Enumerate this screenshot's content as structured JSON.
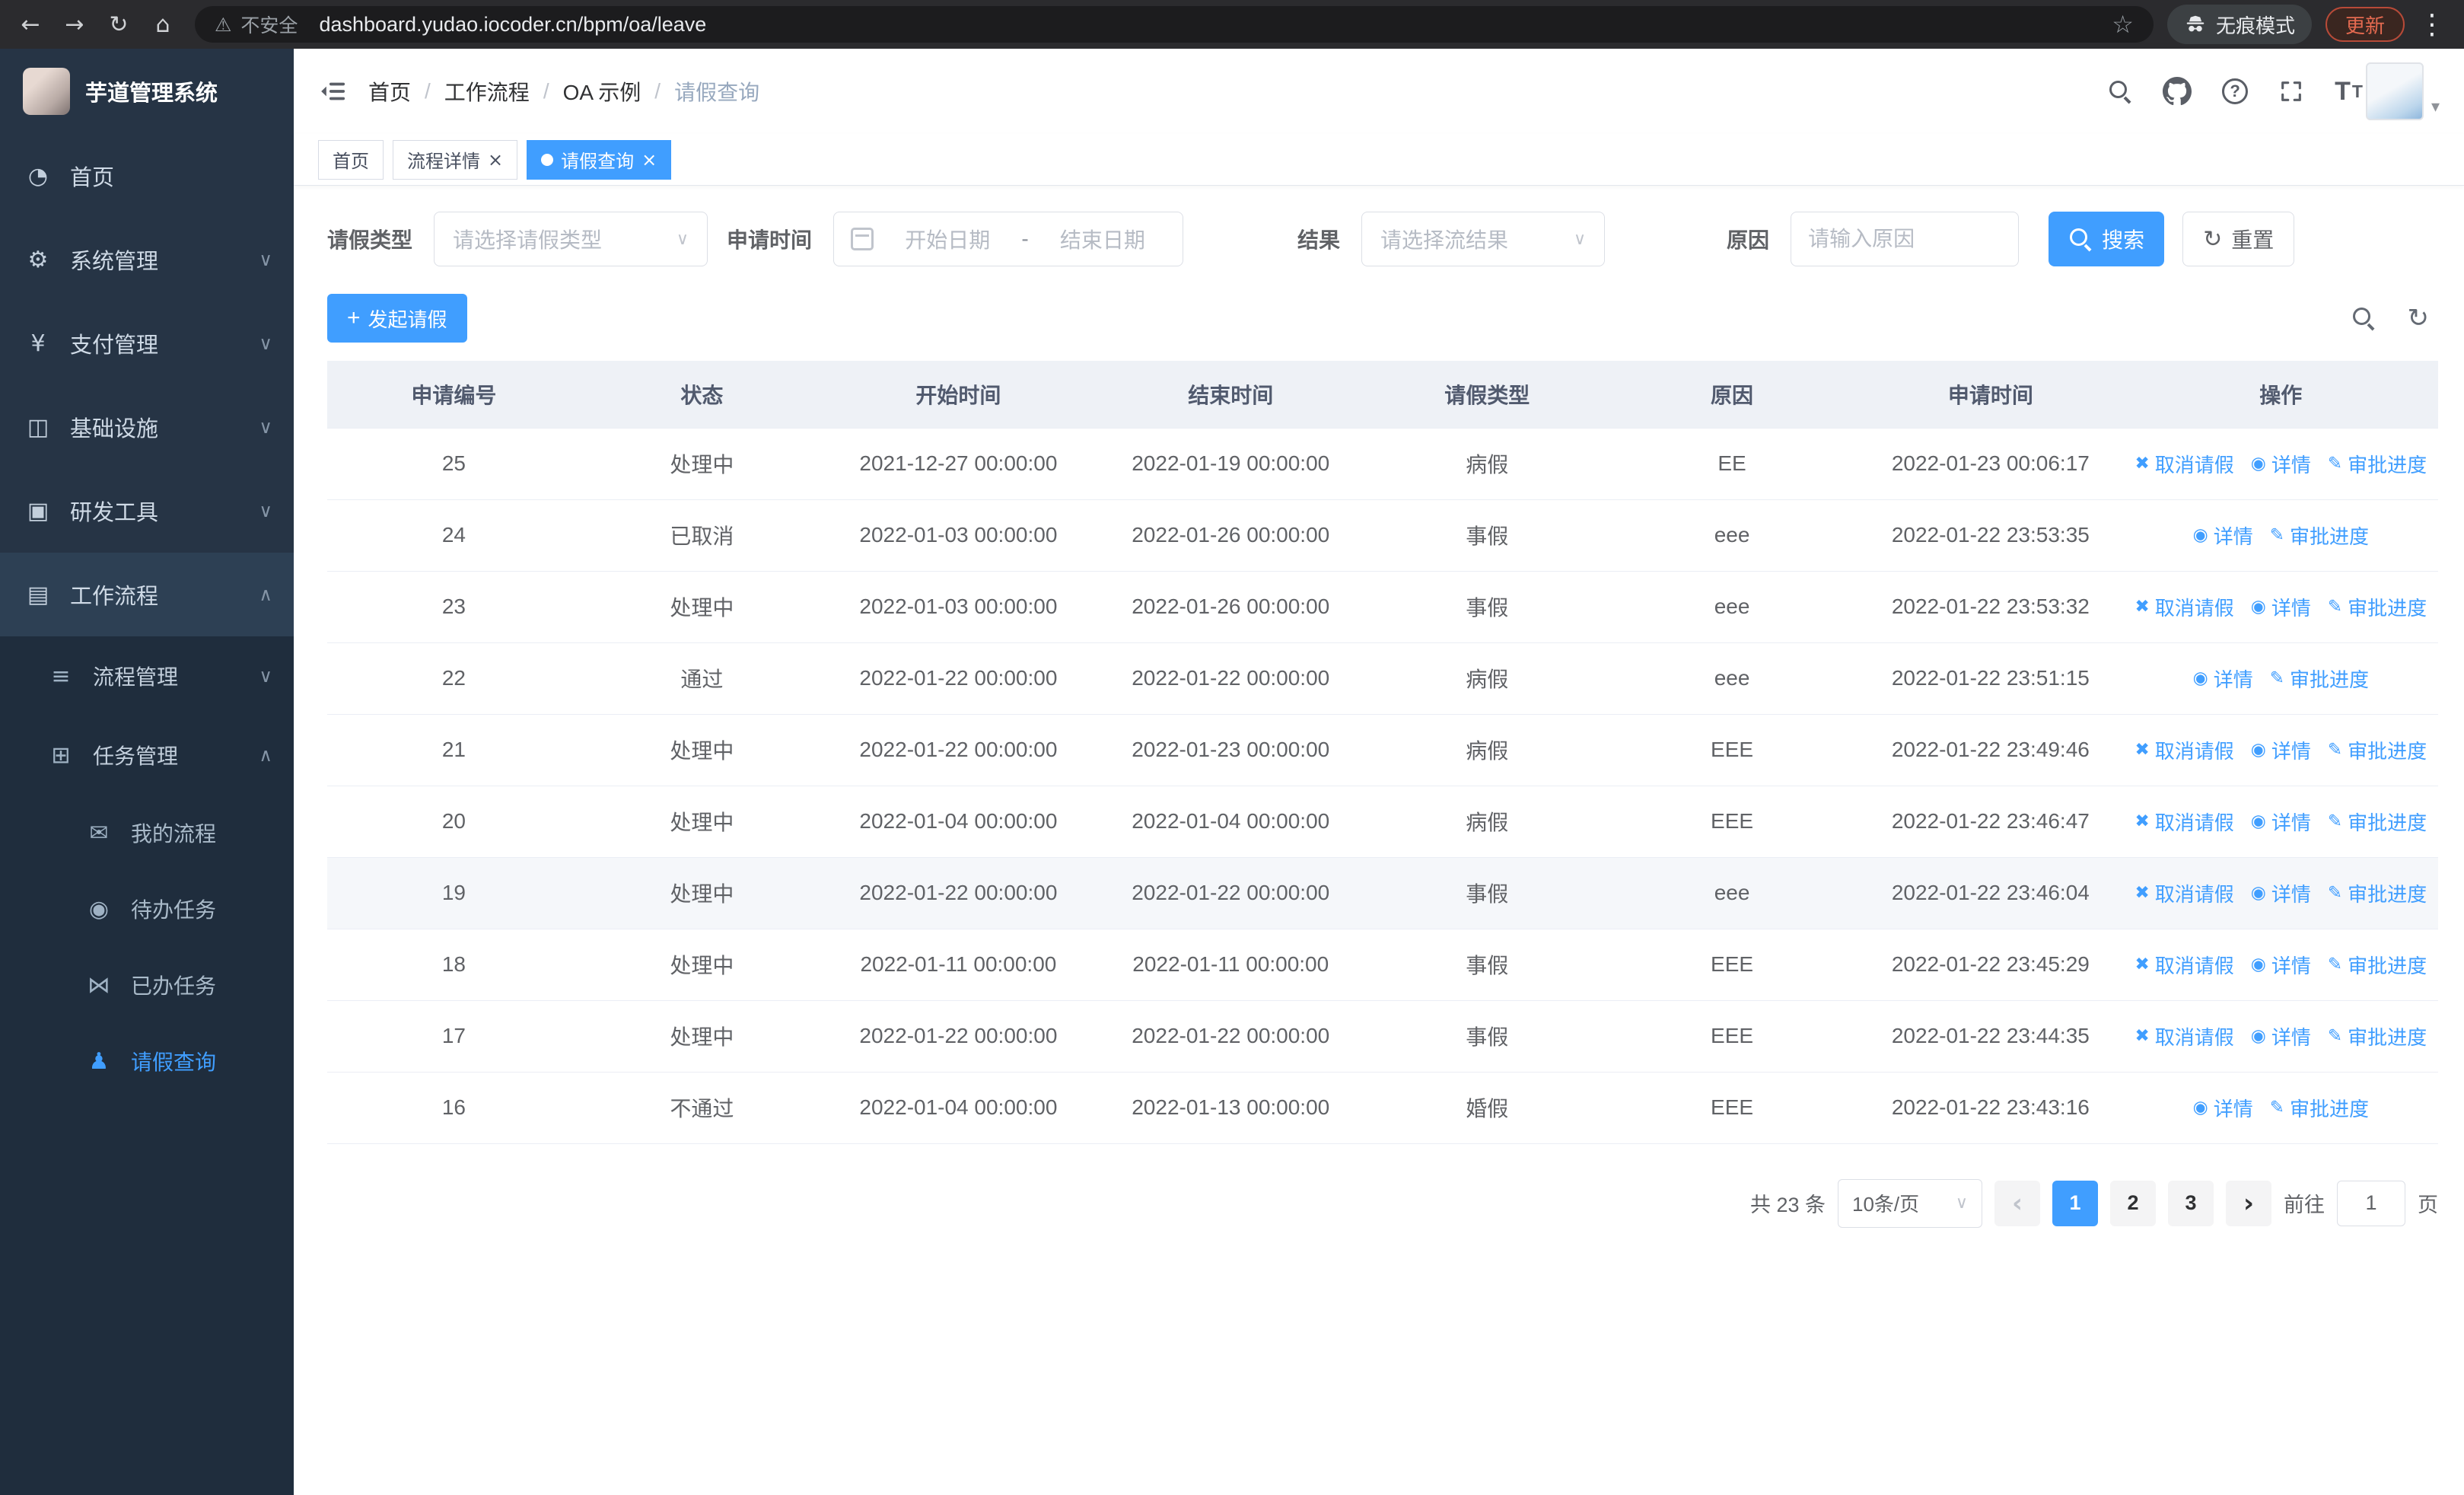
{
  "colors": {
    "accent": "#409eff",
    "sidebar_bg": "#1f2d3d",
    "sidebar_item_bg": "#263445",
    "table_header_bg": "#eef1f6"
  },
  "browser": {
    "nav": [
      "back",
      "forward",
      "reload",
      "home"
    ],
    "security_label": "不安全",
    "url": "dashboard.yudao.iocoder.cn/bpm/oa/leave",
    "incognito_label": "无痕模式",
    "update_label": "更新"
  },
  "sidebar": {
    "app_title": "芋道管理系统",
    "items": [
      {
        "key": "home",
        "label": "首页",
        "icon": "dashboard",
        "level": 1
      },
      {
        "key": "system",
        "label": "系统管理",
        "icon": "gear",
        "level": 1,
        "chevron": "down"
      },
      {
        "key": "payment",
        "label": "支付管理",
        "icon": "yen",
        "level": 1,
        "chevron": "down"
      },
      {
        "key": "infra",
        "label": "基础设施",
        "icon": "monitor",
        "level": 1,
        "chevron": "down"
      },
      {
        "key": "devtools",
        "label": "研发工具",
        "icon": "tools",
        "level": 1,
        "chevron": "down"
      },
      {
        "key": "workflow",
        "label": "工作流程",
        "icon": "briefcase",
        "level": 1,
        "chevron": "up",
        "open": true
      },
      {
        "key": "process-mgmt",
        "label": "流程管理",
        "icon": "list",
        "level": 2,
        "chevron": "down"
      },
      {
        "key": "task-mgmt",
        "label": "任务管理",
        "icon": "tasks",
        "level": 2,
        "chevron": "up",
        "open": true
      },
      {
        "key": "my-process",
        "label": "我的流程",
        "icon": "chat",
        "level": 3
      },
      {
        "key": "todo-tasks",
        "label": "待办任务",
        "icon": "eye",
        "level": 3
      },
      {
        "key": "done-tasks",
        "label": "已办任务",
        "icon": "link",
        "level": 3
      },
      {
        "key": "leave-query",
        "label": "请假查询",
        "icon": "user",
        "level": 3,
        "active": true
      }
    ]
  },
  "header": {
    "breadcrumb": [
      "首页",
      "工作流程",
      "OA 示例",
      "请假查询"
    ],
    "icons": [
      "search",
      "github",
      "help",
      "fullscreen",
      "font-size"
    ]
  },
  "tags": [
    {
      "key": "home",
      "label": "首页",
      "closable": false,
      "active": false
    },
    {
      "key": "process-detail",
      "label": "流程详情",
      "closable": true,
      "active": false
    },
    {
      "key": "leave-query",
      "label": "请假查询",
      "closable": true,
      "active": true
    }
  ],
  "filters": {
    "leave_type_label": "请假类型",
    "leave_type_placeholder": "请选择请假类型",
    "apply_time_label": "申请时间",
    "start_placeholder": "开始日期",
    "range_separator": "-",
    "end_placeholder": "结束日期",
    "result_label": "结果",
    "result_placeholder": "请选择流结果",
    "reason_label": "原因",
    "reason_placeholder": "请输入原因",
    "search_label": "搜索",
    "reset_label": "重置"
  },
  "toolbar": {
    "create_label": "发起请假",
    "icons": [
      "search",
      "refresh"
    ]
  },
  "table": {
    "columns": [
      "申请编号",
      "状态",
      "开始时间",
      "结束时间",
      "请假类型",
      "原因",
      "申请时间",
      "操作"
    ],
    "actions": {
      "cancel": "取消请假",
      "detail": "详情",
      "progress": "审批进度"
    },
    "rows": [
      {
        "id": "25",
        "status": "处理中",
        "start": "2021-12-27 00:00:00",
        "end": "2022-01-19 00:00:00",
        "type": "病假",
        "reason": "EE",
        "apply": "2022-01-23 00:06:17",
        "cancel": true
      },
      {
        "id": "24",
        "status": "已取消",
        "start": "2022-01-03 00:00:00",
        "end": "2022-01-26 00:00:00",
        "type": "事假",
        "reason": "eee",
        "apply": "2022-01-22 23:53:35",
        "cancel": false
      },
      {
        "id": "23",
        "status": "处理中",
        "start": "2022-01-03 00:00:00",
        "end": "2022-01-26 00:00:00",
        "type": "事假",
        "reason": "eee",
        "apply": "2022-01-22 23:53:32",
        "cancel": true
      },
      {
        "id": "22",
        "status": "通过",
        "start": "2022-01-22 00:00:00",
        "end": "2022-01-22 00:00:00",
        "type": "病假",
        "reason": "eee",
        "apply": "2022-01-22 23:51:15",
        "cancel": false
      },
      {
        "id": "21",
        "status": "处理中",
        "start": "2022-01-22 00:00:00",
        "end": "2022-01-23 00:00:00",
        "type": "病假",
        "reason": "EEE",
        "apply": "2022-01-22 23:49:46",
        "cancel": true
      },
      {
        "id": "20",
        "status": "处理中",
        "start": "2022-01-04 00:00:00",
        "end": "2022-01-04 00:00:00",
        "type": "病假",
        "reason": "EEE",
        "apply": "2022-01-22 23:46:47",
        "cancel": true
      },
      {
        "id": "19",
        "status": "处理中",
        "start": "2022-01-22 00:00:00",
        "end": "2022-01-22 00:00:00",
        "type": "事假",
        "reason": "eee",
        "apply": "2022-01-22 23:46:04",
        "cancel": true,
        "hover": true
      },
      {
        "id": "18",
        "status": "处理中",
        "start": "2022-01-11 00:00:00",
        "end": "2022-01-11 00:00:00",
        "type": "事假",
        "reason": "EEE",
        "apply": "2022-01-22 23:45:29",
        "cancel": true
      },
      {
        "id": "17",
        "status": "处理中",
        "start": "2022-01-22 00:00:00",
        "end": "2022-01-22 00:00:00",
        "type": "事假",
        "reason": "EEE",
        "apply": "2022-01-22 23:44:35",
        "cancel": true
      },
      {
        "id": "16",
        "status": "不通过",
        "start": "2022-01-04 00:00:00",
        "end": "2022-01-13 00:00:00",
        "type": "婚假",
        "reason": "EEE",
        "apply": "2022-01-22 23:43:16",
        "cancel": false
      }
    ]
  },
  "pagination": {
    "total_label": "共 23 条",
    "page_size": "10条/页",
    "pages": [
      "1",
      "2",
      "3"
    ],
    "active_page": "1",
    "goto_label": "前往",
    "goto_value": "1",
    "page_label": "页"
  }
}
